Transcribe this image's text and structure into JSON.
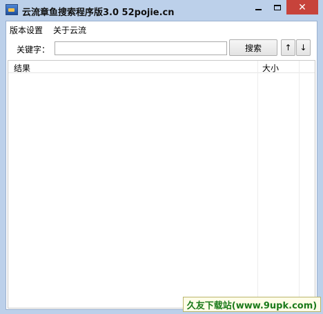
{
  "window": {
    "title": "云流章鱼搜索程序版3.0    52pojie.cn",
    "close_glyph": "✕",
    "accent_close": "#c7433b"
  },
  "menubar": {
    "items": [
      {
        "label": "版本设置"
      },
      {
        "label": "关于云流"
      }
    ]
  },
  "search": {
    "label": "关键字：",
    "value": "",
    "button_label": "搜索",
    "up_label": "↑",
    "down_label": "↓"
  },
  "results": {
    "columns": [
      "结果",
      "大小"
    ],
    "rows": []
  },
  "watermark": {
    "text": "久友下载站(www.9upk.com)"
  }
}
